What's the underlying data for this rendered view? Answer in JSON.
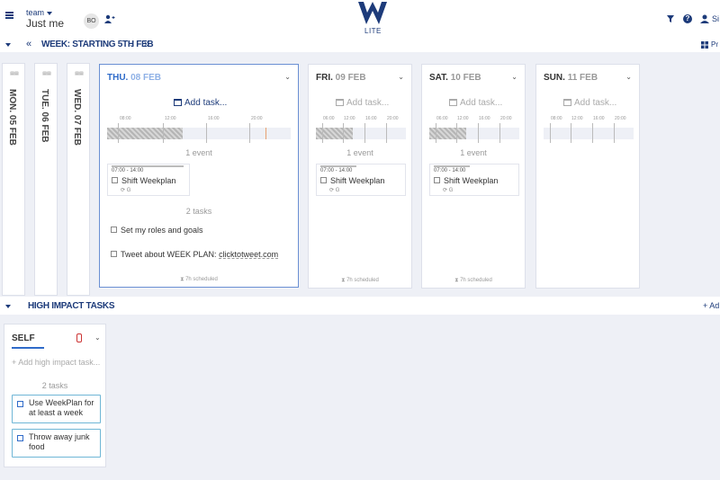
{
  "topbar": {
    "team_label": "team",
    "team_name": "Just me",
    "avatar_initials": "BO",
    "logo_letter": "W",
    "logo_sub": "LITE",
    "right_truncated": "Si"
  },
  "weekbar": {
    "prev": "«",
    "title": "WEEK: STARTING 5TH FEB",
    "chevron": "⌄",
    "next": "»",
    "right_truncated": "Pr"
  },
  "collapsed_days": [
    {
      "label": "MON. 05 FEB"
    },
    {
      "label": "TUE. 06 FEB"
    },
    {
      "label": "WED. 07 FEB"
    }
  ],
  "days": {
    "thu": {
      "name": "THU.",
      "date": "08 FEB",
      "add_task": "Add task...",
      "timeline_labels": [
        "08:00",
        "12:00",
        "16:00",
        "20:00"
      ],
      "events_count": "1 event",
      "event": {
        "time": "07:00 - 14:00",
        "title": "Shift Weekplan"
      },
      "tasks_count": "2 tasks",
      "tasks": [
        "Set my roles and goals",
        "Tweet about WEEK PLAN: ",
        "clicktotweet.com"
      ],
      "scheduled": "7h scheduled"
    },
    "fri": {
      "name": "FRI.",
      "date": "09 FEB",
      "add_task": "Add task...",
      "timeline_labels": [
        "06:00",
        "12:00",
        "16:00",
        "20:00"
      ],
      "events_count": "1 event",
      "event": {
        "time": "07:00 - 14:00",
        "title": "Shift Weekplan"
      },
      "scheduled": "7h scheduled"
    },
    "sat": {
      "name": "SAT.",
      "date": "10 FEB",
      "add_task": "Add task...",
      "timeline_labels": [
        "06:00",
        "12:00",
        "16:00",
        "20:00"
      ],
      "events_count": "1 event",
      "event": {
        "time": "07:00 - 14:00",
        "title": "Shift Weekplan"
      },
      "scheduled": "7h scheduled"
    },
    "sun": {
      "name": "SUN.",
      "date": "11 FEB",
      "add_task": "Add task...",
      "timeline_labels": [
        "08:00",
        "12:00",
        "16:00",
        "20:00"
      ]
    }
  },
  "high_impact": {
    "title": "HIGH IMPACT TASKS",
    "add_truncated": "Ad",
    "self": {
      "title": "SELF",
      "add": "Add high impact task...",
      "count": "2 tasks",
      "tasks": [
        "Use WeekPlan for at least a week",
        "Throw away junk food"
      ]
    }
  },
  "colors": {
    "brand": "#1d3b7a",
    "active_day": "#2f6bc9",
    "background": "#eef0f6"
  }
}
